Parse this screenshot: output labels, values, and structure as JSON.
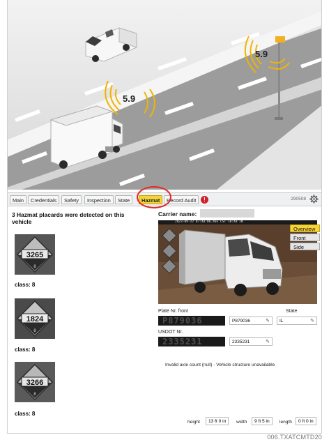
{
  "hero": {
    "speed_near": "5.9",
    "speed_far": "5.9"
  },
  "tabs": [
    {
      "label": "Main"
    },
    {
      "label": "Credentials"
    },
    {
      "label": "Safety"
    },
    {
      "label": "Inspection"
    },
    {
      "label": "State"
    },
    {
      "label": "Hazmat",
      "active": true
    },
    {
      "label": "Record Audit"
    }
  ],
  "alert_badge": "!",
  "record_number": "290508",
  "hazmat": {
    "title": "3 Hazmat placards were detected on this vehicle",
    "placards": [
      {
        "un_number": "3265",
        "class_digit": "8",
        "class_label": "class: 8"
      },
      {
        "un_number": "1824",
        "class_digit": "8",
        "class_label": "class: 8"
      },
      {
        "un_number": "3266",
        "class_digit": "8",
        "class_label": "class: 8"
      }
    ]
  },
  "carrier": {
    "label": "Carrier name:"
  },
  "camera": {
    "timestamp": "2023-09-22 07:48:06.403 CST   10:40 IN",
    "views": [
      {
        "label": "Overview",
        "active": true
      },
      {
        "label": "Front"
      },
      {
        "label": "Side"
      }
    ]
  },
  "plate": {
    "label": "Plate Nr. front",
    "image_text": "P879036",
    "value": "P879036",
    "state_label": "State",
    "state_value": "IL"
  },
  "usdot": {
    "label": "USDOT Nr.",
    "image_text": "2335231",
    "value": "2335231"
  },
  "axle_message": "Invalid axle count (null) - Vehicle structure unavailable",
  "dimensions": {
    "height_label": "height",
    "height_value": "13 ft 0 in",
    "width_label": "width",
    "width_value": "9 ft 5 in",
    "length_label": "length",
    "length_value": "0 ft 0 in"
  },
  "caption": "006.TXATCMTD20",
  "colors": {
    "active_tab": "#f3d43a",
    "highlight_ring": "#e02a2a",
    "signal_waves": "#f0b400",
    "alert": "#d0202a"
  }
}
